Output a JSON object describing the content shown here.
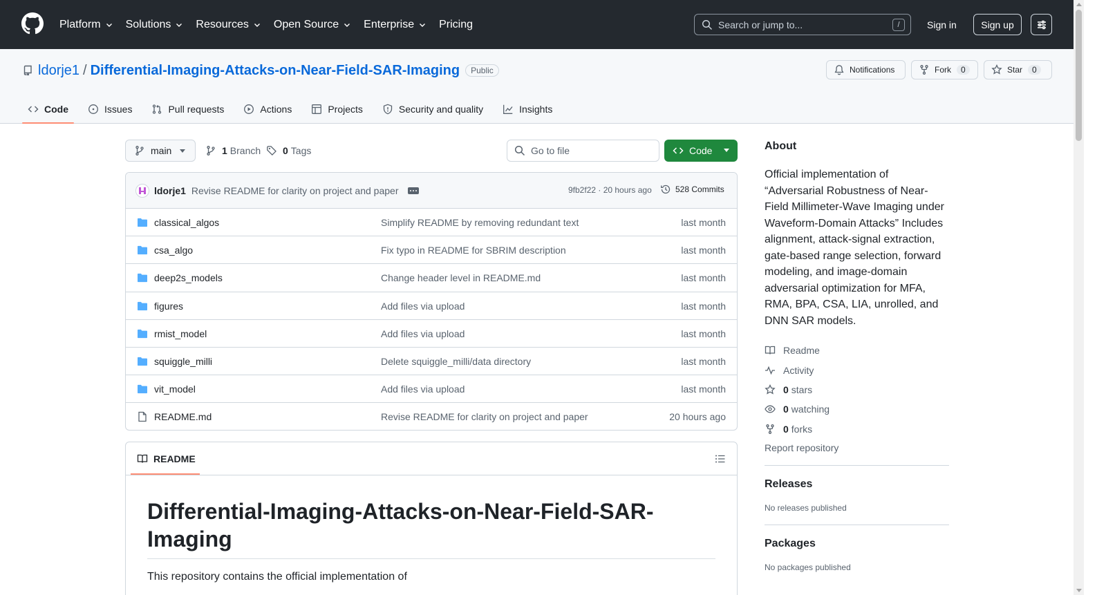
{
  "header": {
    "nav": [
      {
        "label": "Platform",
        "dropdown": true
      },
      {
        "label": "Solutions",
        "dropdown": true
      },
      {
        "label": "Resources",
        "dropdown": true
      },
      {
        "label": "Open Source",
        "dropdown": true
      },
      {
        "label": "Enterprise",
        "dropdown": true
      },
      {
        "label": "Pricing",
        "dropdown": false
      }
    ],
    "search_placeholder": "Search or jump to...",
    "search_shortcut": "/",
    "sign_in": "Sign in",
    "sign_up": "Sign up"
  },
  "repo": {
    "owner": "ldorje1",
    "separator": "/",
    "name": "Differential-Imaging-Attacks-on-Near-Field-SAR-Imaging",
    "visibility": "Public",
    "notifications_label": "Notifications",
    "fork_label": "Fork",
    "fork_count": "0",
    "star_label": "Star",
    "star_count": "0"
  },
  "tabs": [
    {
      "label": "Code",
      "icon": "code-icon",
      "active": true
    },
    {
      "label": "Issues",
      "icon": "issue-icon",
      "active": false
    },
    {
      "label": "Pull requests",
      "icon": "pull-request-icon",
      "active": false
    },
    {
      "label": "Actions",
      "icon": "play-icon",
      "active": false
    },
    {
      "label": "Projects",
      "icon": "table-icon",
      "active": false
    },
    {
      "label": "Security and quality",
      "icon": "shield-icon",
      "active": false
    },
    {
      "label": "Insights",
      "icon": "graph-icon",
      "active": false
    }
  ],
  "toolbar": {
    "branch": "main",
    "branch_count": "1",
    "branch_label": "Branch",
    "tag_count": "0",
    "tag_label": "Tags",
    "go_to_file": "Go to file",
    "code_label": "Code"
  },
  "commit": {
    "author": "ldorje1",
    "message": "Revise README for clarity on project and paper",
    "hash_time": "9fb2f22 · 20 hours ago",
    "count_label": "528 Commits"
  },
  "files": [
    {
      "name": "classical_algos",
      "type": "folder",
      "message": "Simplify README by removing redundant text",
      "date": "last month"
    },
    {
      "name": "csa_algo",
      "type": "folder",
      "message": "Fix typo in README for SBRIM description",
      "date": "last month"
    },
    {
      "name": "deep2s_models",
      "type": "folder",
      "message": "Change header level in README.md",
      "date": "last month"
    },
    {
      "name": "figures",
      "type": "folder",
      "message": "Add files via upload",
      "date": "last month"
    },
    {
      "name": "rmist_model",
      "type": "folder",
      "message": "Add files via upload",
      "date": "last month"
    },
    {
      "name": "squiggle_milli",
      "type": "folder",
      "message": "Delete squiggle_milli/data directory",
      "date": "last month"
    },
    {
      "name": "vit_model",
      "type": "folder",
      "message": "Add files via upload",
      "date": "last month"
    },
    {
      "name": "README.md",
      "type": "file",
      "message": "Revise README for clarity on project and paper",
      "date": "20 hours ago"
    }
  ],
  "readme": {
    "tab_label": "README",
    "title": "Differential-Imaging-Attacks-on-Near-Field-SAR-Imaging",
    "intro": "This repository contains the official implementation of"
  },
  "sidebar": {
    "about_title": "About",
    "about_text": "Official implementation of “Adversarial Robustness of Near-Field Millimeter-Wave Imaging under Waveform-Domain Attacks” Includes alignment, attack-signal extraction, gate-based range selection, forward modeling, and image-domain adversarial optimization for MFA, RMA, BPA, CSA, LIA, unrolled, and DNN SAR models.",
    "readme_label": "Readme",
    "activity_label": "Activity",
    "stars_count": "0",
    "stars_label": "stars",
    "watching_count": "0",
    "watching_label": "watching",
    "forks_count": "0",
    "forks_label": "forks",
    "report_label": "Report repository",
    "releases_title": "Releases",
    "releases_text": "No releases published",
    "packages_title": "Packages",
    "packages_text": "No packages published"
  },
  "colors": {
    "header_bg": "#24292f",
    "link": "#0969da",
    "primary_button": "#1f883d",
    "active_tab_underline": "#fd8c73",
    "folder_icon": "#54aeff"
  }
}
